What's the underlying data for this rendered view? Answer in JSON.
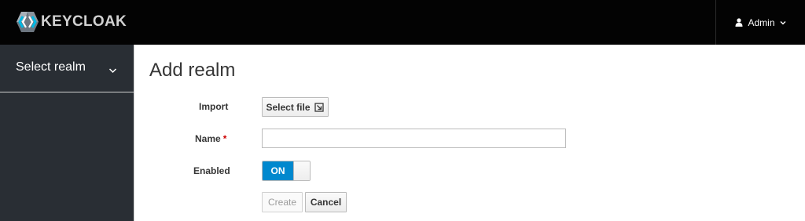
{
  "header": {
    "logo_text": "KEYCLOAK",
    "user_label": "Admin",
    "icons": {
      "logo": "keycloak-logo-icon",
      "user": "user-icon",
      "caret": "caret-down-icon"
    }
  },
  "sidebar": {
    "realm_selector_label": "Select realm",
    "icons": {
      "chevron": "chevron-down-icon"
    }
  },
  "main": {
    "title": "Add realm",
    "form": {
      "import_label": "Import",
      "select_file_label": "Select file",
      "name_label": "Name",
      "name_required_marker": "*",
      "name_value": "",
      "enabled_label": "Enabled",
      "enabled_toggle_text": "ON",
      "enabled": true
    },
    "buttons": {
      "create": "Create",
      "cancel": "Cancel"
    }
  },
  "colors": {
    "topbar": "#030303",
    "sidebar": "#292e34",
    "toggle_on": "#0088ce",
    "required": "#cc0000"
  }
}
